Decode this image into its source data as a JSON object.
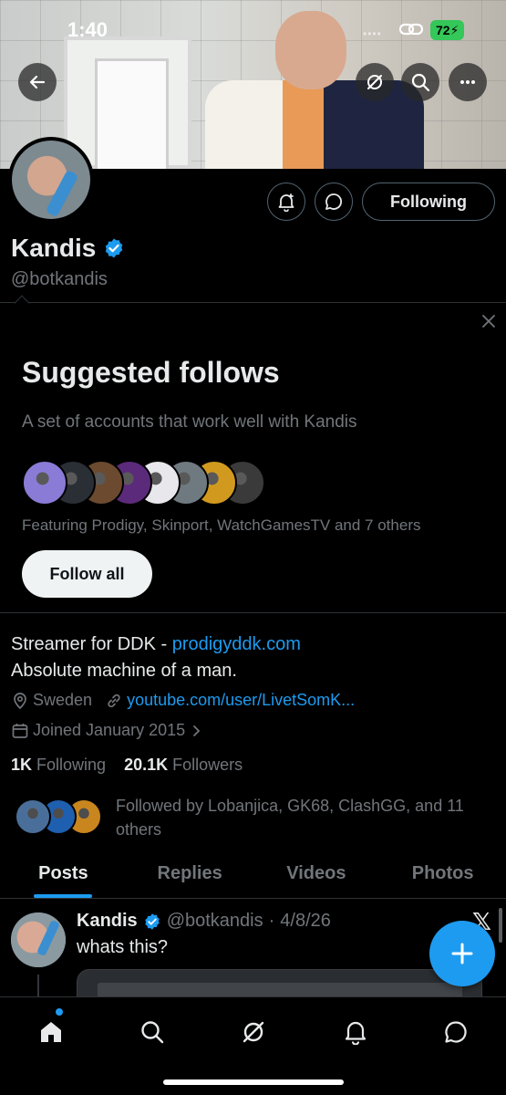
{
  "status_bar": {
    "time": "1:40",
    "battery": "72"
  },
  "profile": {
    "name": "Kandis",
    "handle": "@botkandis",
    "following_button": "Following",
    "bio_prefix": "Streamer for DDK - ",
    "bio_link": "prodigyddk.com",
    "bio_line2": "Absolute machine of a man.",
    "location": "Sweden",
    "website": "youtube.com/user/LivetSomK...",
    "joined": "Joined January 2015",
    "following_count": "1K",
    "following_label": "Following",
    "followers_count": "20.1K",
    "followers_label": "Followers",
    "followed_by": "Followed by Lobanjica, GK68, ClashGG, and 11 others"
  },
  "suggested": {
    "title": "Suggested follows",
    "subtitle": "A set of accounts that work well with Kandis",
    "featuring": "Featuring Prodigy, Skinport, WatchGamesTV and 7 others",
    "follow_all": "Follow all",
    "avatar_colors": [
      "#8a7bd6",
      "#2a2f36",
      "#6b4a30",
      "#5b2a7a",
      "#e8e8ec",
      "#6f7a80",
      "#d19a1e",
      "#3a3a3a"
    ]
  },
  "followed_by_colors": [
    "#4a6e9a",
    "#1e5fb0",
    "#c9861f"
  ],
  "tabs": [
    {
      "label": "Posts",
      "active": true
    },
    {
      "label": "Replies",
      "active": false
    },
    {
      "label": "Videos",
      "active": false
    },
    {
      "label": "Photos",
      "active": false
    }
  ],
  "post": {
    "name": "Kandis",
    "handle": "@botkandis",
    "separator": "·",
    "date": "4/8/26",
    "text": "whats this?"
  },
  "colors": {
    "accent": "#1d9bf0",
    "battery": "#34c759",
    "text_primary": "#e7e9ea",
    "text_secondary": "#71767b",
    "border": "#2f3336"
  },
  "icons": {
    "back": "back-arrow-icon",
    "grok": "grok-icon",
    "search": "search-icon",
    "more": "more-icon",
    "notify": "bell-plus-icon",
    "message": "message-icon",
    "verified": "verified-badge-icon",
    "close": "close-icon",
    "location": "location-pin-icon",
    "link": "link-icon",
    "calendar": "calendar-icon",
    "compose": "plus-icon",
    "home": "home-icon",
    "nav_search": "search-icon",
    "nav_grok": "grok-icon",
    "notifications": "bell-icon",
    "dm": "message-icon"
  }
}
